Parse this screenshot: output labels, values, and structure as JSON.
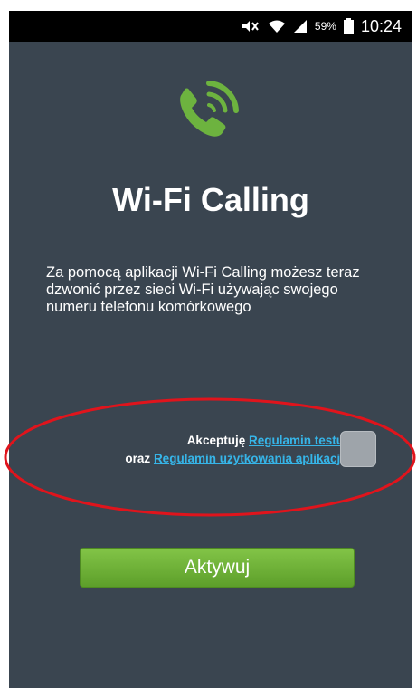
{
  "status_bar": {
    "battery_percent": "59%",
    "time": "10:24",
    "icons": [
      "mute-icon",
      "wifi-icon",
      "signal-icon",
      "battery-icon"
    ]
  },
  "app": {
    "logo_icon": "phone-wifi-icon",
    "title": "Wi-Fi Calling",
    "description": "Za pomocą aplikacji Wi-Fi Calling możesz teraz dzwonić przez sieci Wi-Fi używając swojego numeru telefonu komórkowego"
  },
  "terms": {
    "accept_prefix": "Akceptuję",
    "test_terms_link": "Regulamin testu",
    "conjunction": "oraz",
    "app_terms_link": "Regulamin użytkowania aplikacji",
    "checked": false
  },
  "activate_button": "Aktywuj",
  "colors": {
    "background": "#3a4550",
    "accent_green": "#6db33f",
    "link_blue": "#36b5e8",
    "annotation_red": "#e0141c"
  }
}
